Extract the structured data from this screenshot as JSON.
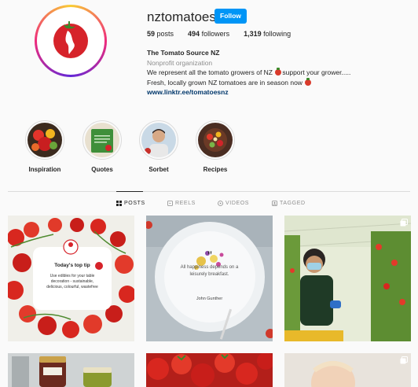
{
  "profile": {
    "username": "nztomatoes",
    "follow_label": "Follow",
    "posts_count": "59",
    "posts_label": "posts",
    "followers_count": "494",
    "followers_label": "followers",
    "following_count": "1,319",
    "following_label": "following",
    "display_name": "The Tomato Source NZ",
    "category": "Nonprofit organization",
    "bio_line1": "We represent all the tomato growers of NZ",
    "bio_line1b": "support your grower.....",
    "bio_line2": "Fresh, locally grown NZ tomatoes are in season now",
    "link": "www.linktr.ee/tomatoesnz"
  },
  "highlights": [
    {
      "label": "Inspiration"
    },
    {
      "label": "Quotes"
    },
    {
      "label": "Sorbet"
    },
    {
      "label": "Recipes"
    }
  ],
  "tabs": [
    {
      "label": "POSTS",
      "active": true
    },
    {
      "label": "REELS",
      "active": false
    },
    {
      "label": "VIDEOS",
      "active": false
    },
    {
      "label": "TAGGED",
      "active": false
    }
  ],
  "posts": {
    "tip": {
      "title": "Today's top tip",
      "body1": "Use edibles for your table",
      "body2": "decoration - sustainable,",
      "body3": "delicious, colourful, wastefree"
    },
    "quote": {
      "line1": "All happiness depends on a",
      "line2": "leisurely breakfast.",
      "author": "John Gunther"
    }
  },
  "colors": {
    "accent": "#0095f6",
    "tomato_red": "#d6232a",
    "link": "#00376b"
  }
}
